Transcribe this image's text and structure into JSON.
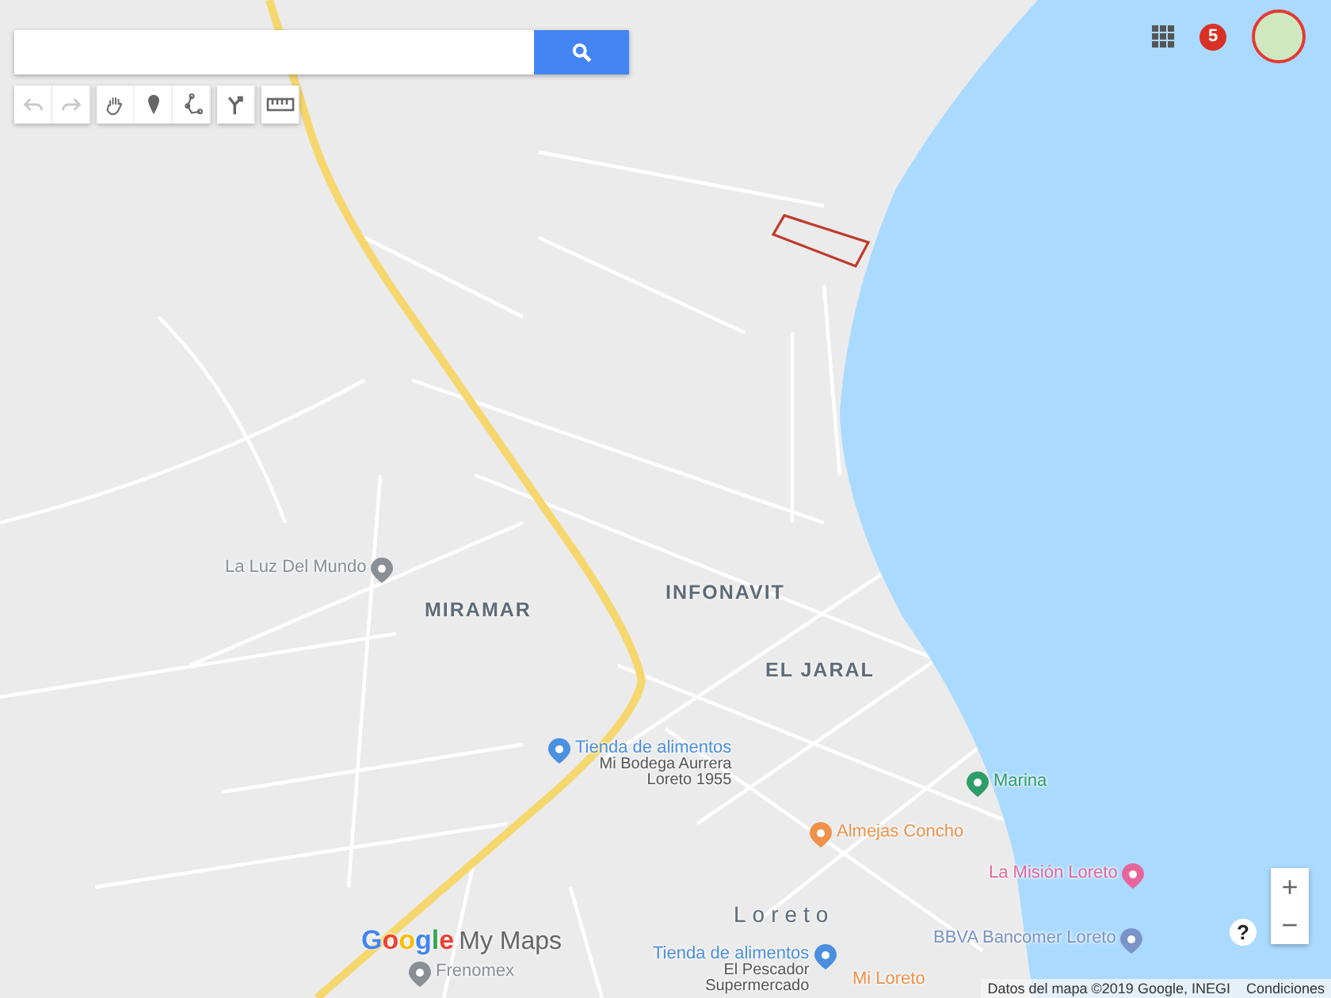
{
  "toolbar": [
    [
      {
        "kind": "undo",
        "disabled": true
      },
      {
        "kind": "redo",
        "disabled": true
      }
    ],
    [
      {
        "kind": "hand",
        "disabled": false
      },
      {
        "kind": "marker",
        "disabled": false
      },
      {
        "kind": "line",
        "disabled": false
      }
    ],
    [
      {
        "kind": "directions",
        "disabled": false
      }
    ],
    [
      {
        "kind": "ruler",
        "disabled": false
      }
    ]
  ],
  "account": {
    "notifications": "5"
  },
  "map": {
    "areas": [
      "MIRAMAR",
      "INFONAVIT",
      "EL JARAL",
      "Loreto"
    ],
    "places": [
      {
        "title": "La Luz Del Mundo",
        "color": "#8a8f96"
      },
      {
        "title": "Tienda de alimentos",
        "subtitle": "Mi Bodega Aurrera\nLoreto 1955",
        "color": "#4a8fe0"
      },
      {
        "title": "Marina",
        "color": "#2e9d6a"
      },
      {
        "title": "Almejas Concho",
        "color": "#f0914a"
      },
      {
        "title": "La Misión Loreto",
        "color": "#e6669b"
      },
      {
        "title": "BBVA Bancomer Loreto",
        "color": "#7b93c9"
      },
      {
        "title": "Frenomex",
        "color": "#8a8f96"
      },
      {
        "title": "Tienda de alimentos",
        "subtitle": "El Pescador\nSupermercado",
        "color": "#4a8fe0"
      },
      {
        "title": "Mi Loreto",
        "color": "#f0914a"
      }
    ],
    "attribution": "Datos del mapa ©2019 Google, INEGI",
    "terms": "Condiciones"
  },
  "logo": {
    "brand": "Google",
    "product": "My Maps"
  },
  "zoom": {
    "in": "+",
    "out": "−"
  },
  "help": "?"
}
